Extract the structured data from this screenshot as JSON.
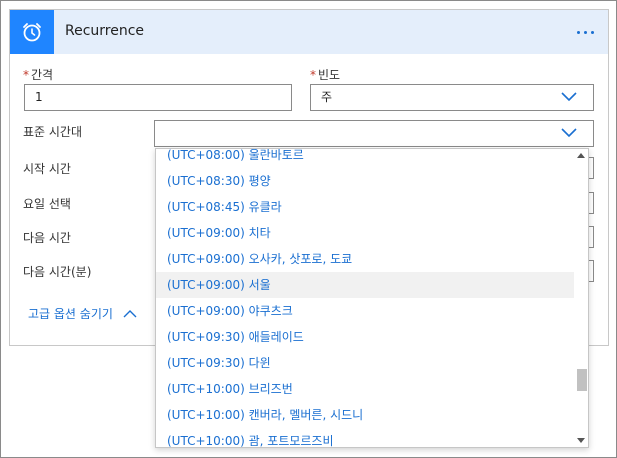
{
  "card": {
    "title": "Recurrence"
  },
  "interval": {
    "label": "간격",
    "required_mark": "*",
    "value": "1"
  },
  "frequency": {
    "label": "빈도",
    "required_mark": "*",
    "value": "주"
  },
  "timezone": {
    "label": "표준 시간대",
    "value": ""
  },
  "start_time": {
    "label": "시작 시간"
  },
  "weekdays": {
    "label": "요일 선택"
  },
  "at_hours": {
    "label": "다음 시간"
  },
  "at_minutes": {
    "label": "다음 시간(분)"
  },
  "advanced_toggle": {
    "label": "고급 옵션 숨기기"
  },
  "timezone_options": [
    "(UTC+08:00) 울란바토르",
    "(UTC+08:30) 평양",
    "(UTC+08:45) 유클라",
    "(UTC+09:00) 치타",
    "(UTC+09:00) 오사카, 삿포로, 도쿄",
    "(UTC+09:00) 서울",
    "(UTC+09:00) 야쿠츠크",
    "(UTC+09:30) 애들레이드",
    "(UTC+09:30) 다윈",
    "(UTC+10:00) 브리즈번",
    "(UTC+10:00) 캔버라, 멜버른, 시드니",
    "(UTC+10:00) 괌, 포트모르즈비"
  ],
  "selected_option_index": 5,
  "colors": {
    "accent": "#1f85ff",
    "header_bg": "#e4eefb",
    "link": "#1a6fd1"
  }
}
